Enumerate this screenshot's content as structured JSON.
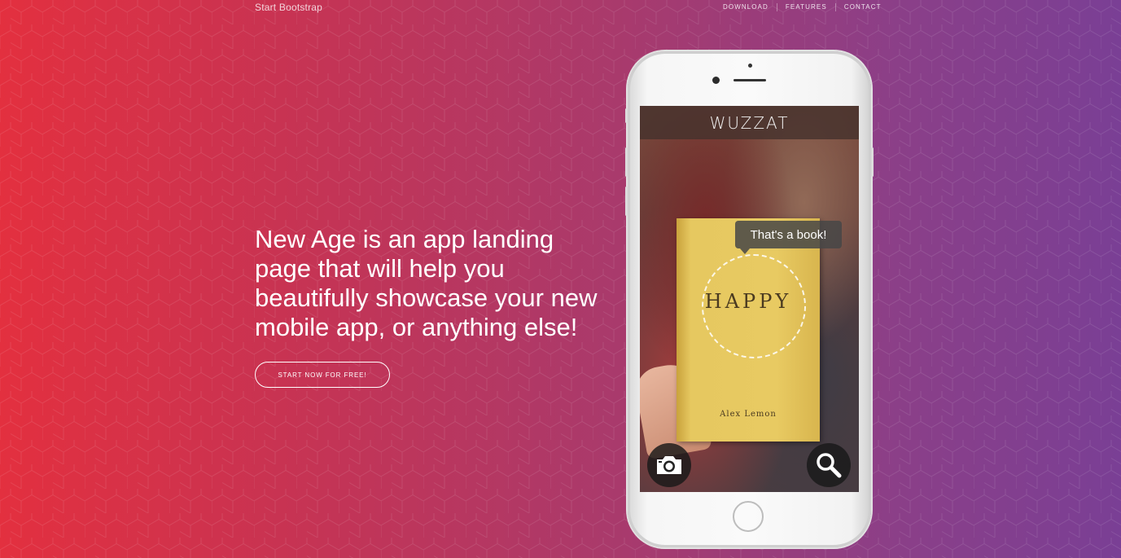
{
  "navbar": {
    "brand": "Start Bootstrap",
    "links": [
      "Download",
      "Features",
      "Contact"
    ]
  },
  "hero": {
    "headline": "New Age is an app landing page that will help you beautifully showcase your new mobile app, or anything else!",
    "cta_label": "Start Now for Free!"
  },
  "phone_screen": {
    "app_title": "WUZZAT",
    "bubble_text": "That's a book!",
    "book_title": "HAPPY",
    "book_author": "Alex Lemon",
    "left_button_icon": "camera-icon",
    "right_button_icon": "search-icon"
  },
  "colors": {
    "gradient_start": "#e3303f",
    "gradient_end": "#7a3f95"
  }
}
